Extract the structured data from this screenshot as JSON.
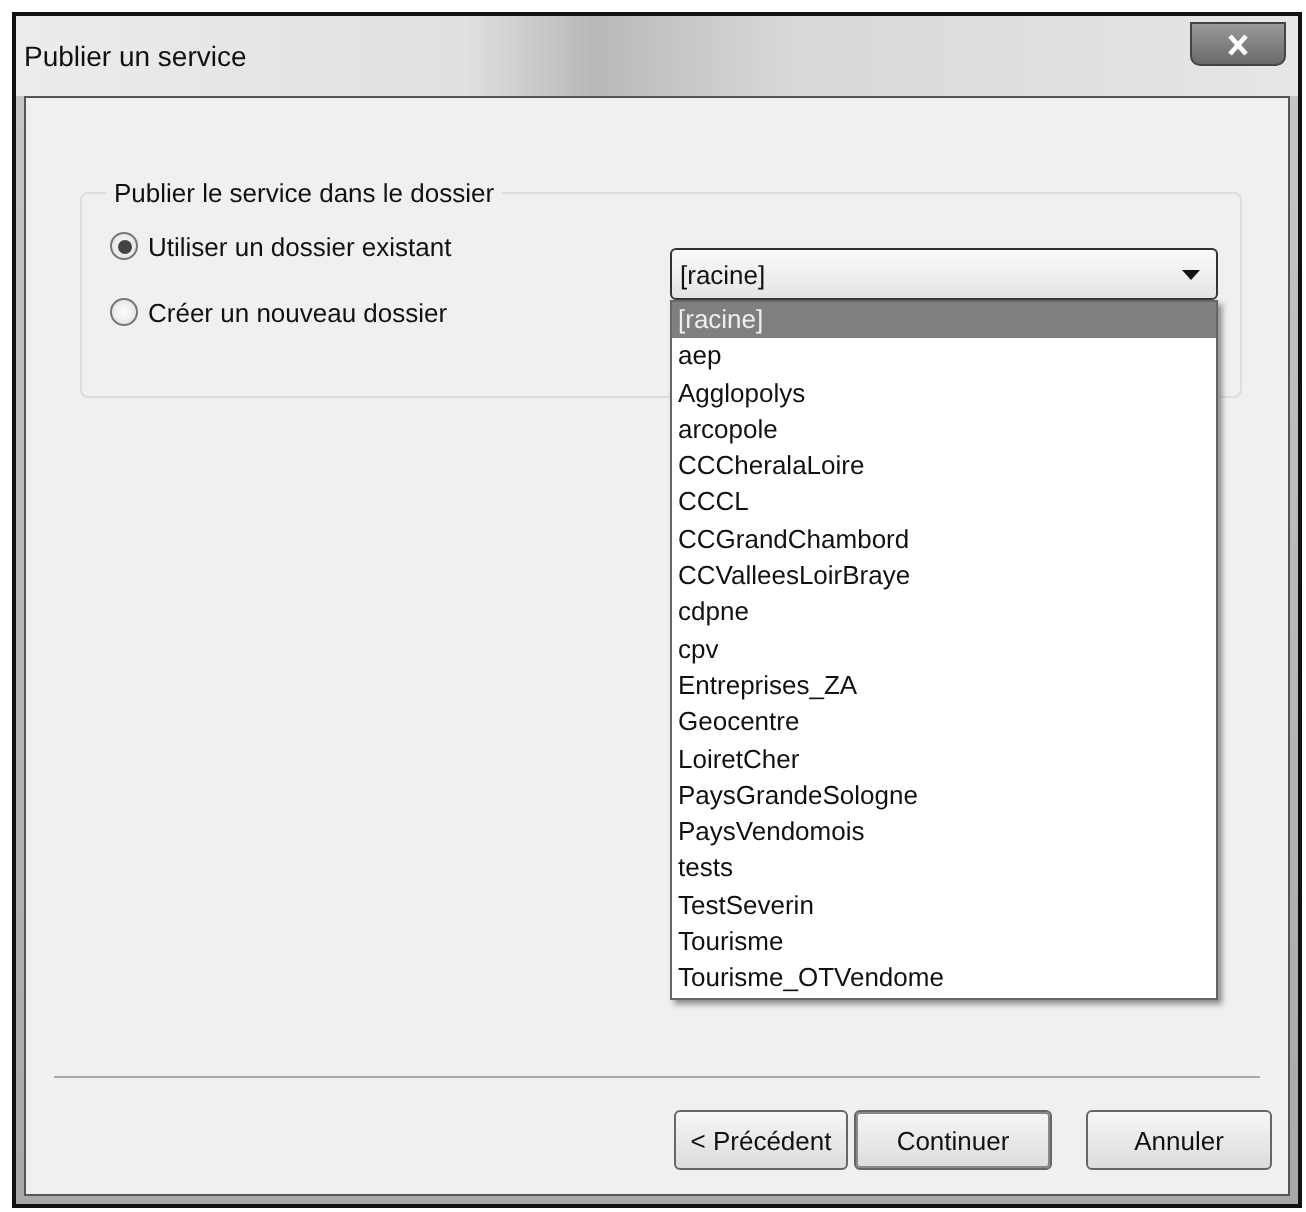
{
  "window": {
    "title": "Publier un service"
  },
  "group": {
    "title": "Publier le service dans le dossier",
    "options": [
      {
        "label": "Utiliser un dossier existant",
        "selected": true
      },
      {
        "label": "Créer un nouveau dossier",
        "selected": false
      }
    ]
  },
  "folder_select": {
    "value": "[racine]",
    "expanded": true,
    "options": [
      {
        "label": "[racine]",
        "selected": true
      },
      {
        "label": "aep",
        "selected": false
      },
      {
        "label": "Agglopolys",
        "selected": false
      },
      {
        "label": "arcopole",
        "selected": false
      },
      {
        "label": "CCCheralaLoire",
        "selected": false
      },
      {
        "label": "CCCL",
        "selected": false
      },
      {
        "label": "CCGrandChambord",
        "selected": false
      },
      {
        "label": "CCValleesLoirBraye",
        "selected": false
      },
      {
        "label": "cdpne",
        "selected": false
      },
      {
        "label": "cpv",
        "selected": false
      },
      {
        "label": "Entreprises_ZA",
        "selected": false
      },
      {
        "label": "Geocentre",
        "selected": false
      },
      {
        "label": "LoiretCher",
        "selected": false
      },
      {
        "label": "PaysGrandeSologne",
        "selected": false
      },
      {
        "label": "PaysVendomois",
        "selected": false
      },
      {
        "label": "tests",
        "selected": false
      },
      {
        "label": "TestSeverin",
        "selected": false
      },
      {
        "label": "Tourisme",
        "selected": false
      },
      {
        "label": "Tourisme_OTVendome",
        "selected": false
      }
    ]
  },
  "buttons": [
    {
      "label": "< Précédent",
      "kind": "normal"
    },
    {
      "label": "Continuer",
      "kind": "default"
    },
    {
      "label": "Annuler",
      "kind": "cancel"
    }
  ]
}
